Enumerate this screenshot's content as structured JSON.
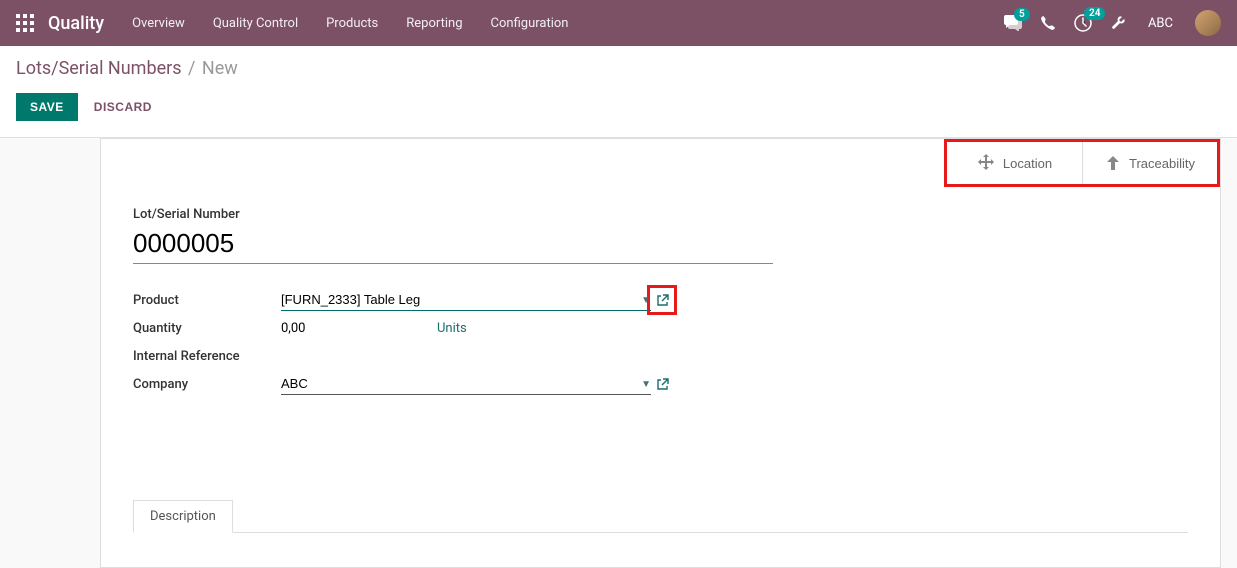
{
  "navbar": {
    "brand": "Quality",
    "items": [
      "Overview",
      "Quality Control",
      "Products",
      "Reporting",
      "Configuration"
    ],
    "messages_badge": "5",
    "activities_badge": "24",
    "user_name": "ABC"
  },
  "breadcrumb": {
    "parent": "Lots/Serial Numbers",
    "current": "New"
  },
  "buttons": {
    "save": "SAVE",
    "discard": "DISCARD"
  },
  "stat_buttons": {
    "location": "Location",
    "traceability": "Traceability"
  },
  "form": {
    "lot_label": "Lot/Serial Number",
    "lot_value": "0000005",
    "product_label": "Product",
    "product_value": "[FURN_2333] Table Leg",
    "quantity_label": "Quantity",
    "quantity_value": "0,00",
    "quantity_unit": "Units",
    "internal_ref_label": "Internal Reference",
    "company_label": "Company",
    "company_value": "ABC"
  },
  "tabs": {
    "description": "Description"
  },
  "icon_names": {
    "apps": "apps-icon",
    "discuss": "discuss-icon",
    "phone": "phone-icon",
    "clock": "clock-icon",
    "wrench": "wrench-icon",
    "move": "move-icon",
    "arrow_up": "arrow-up-icon",
    "external": "external-link-icon",
    "caret": "caret-down-icon"
  },
  "colors": {
    "brand_bg": "#7C5166",
    "accent_teal": "#00786b",
    "highlight_red": "#E8191A"
  }
}
